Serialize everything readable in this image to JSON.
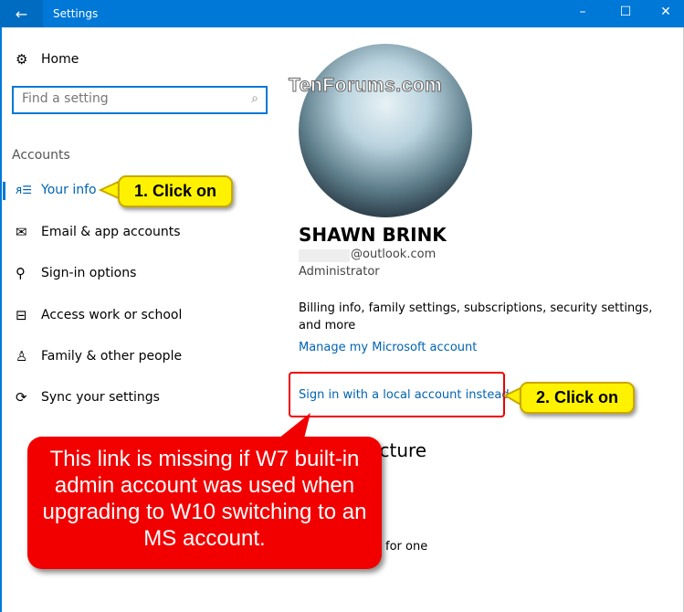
{
  "window": {
    "title": "Settings",
    "back_icon": "arrow-left-icon",
    "minimize": "–",
    "maximize": "☐",
    "close": "✕"
  },
  "sidebar": {
    "home": "Home",
    "search_placeholder": "Find a setting",
    "section": "Accounts",
    "items": [
      {
        "label": "Your info",
        "icon": "person-card-icon",
        "selected": true
      },
      {
        "label": "Email & app accounts",
        "icon": "mail-icon"
      },
      {
        "label": "Sign-in options",
        "icon": "key-icon"
      },
      {
        "label": "Access work or school",
        "icon": "briefcase-icon"
      },
      {
        "label": "Family & other people",
        "icon": "person-add-icon"
      },
      {
        "label": "Sync your settings",
        "icon": "sync-icon"
      }
    ]
  },
  "main": {
    "watermark": "TenForums.com",
    "name": "SHAWN BRINK",
    "email": "@outlook.com",
    "role": "Administrator",
    "billing": "Billing info, family settings, subscriptions, security settings, and more",
    "manage_link": "Manage my Microsoft account",
    "local_link": "Sign in with a local account instead",
    "picture_heading_partial": "ur picture",
    "for_one_partial": "for one"
  },
  "annotations": {
    "callout1": "1. Click on",
    "callout2": "2. Click on",
    "note": "This link is missing if W7 built-in admin account was used when upgrading to W10 switching to an MS account.",
    "accent": "#0078d7",
    "callout_yellow": "#fff200",
    "callout_red": "#f20000"
  }
}
